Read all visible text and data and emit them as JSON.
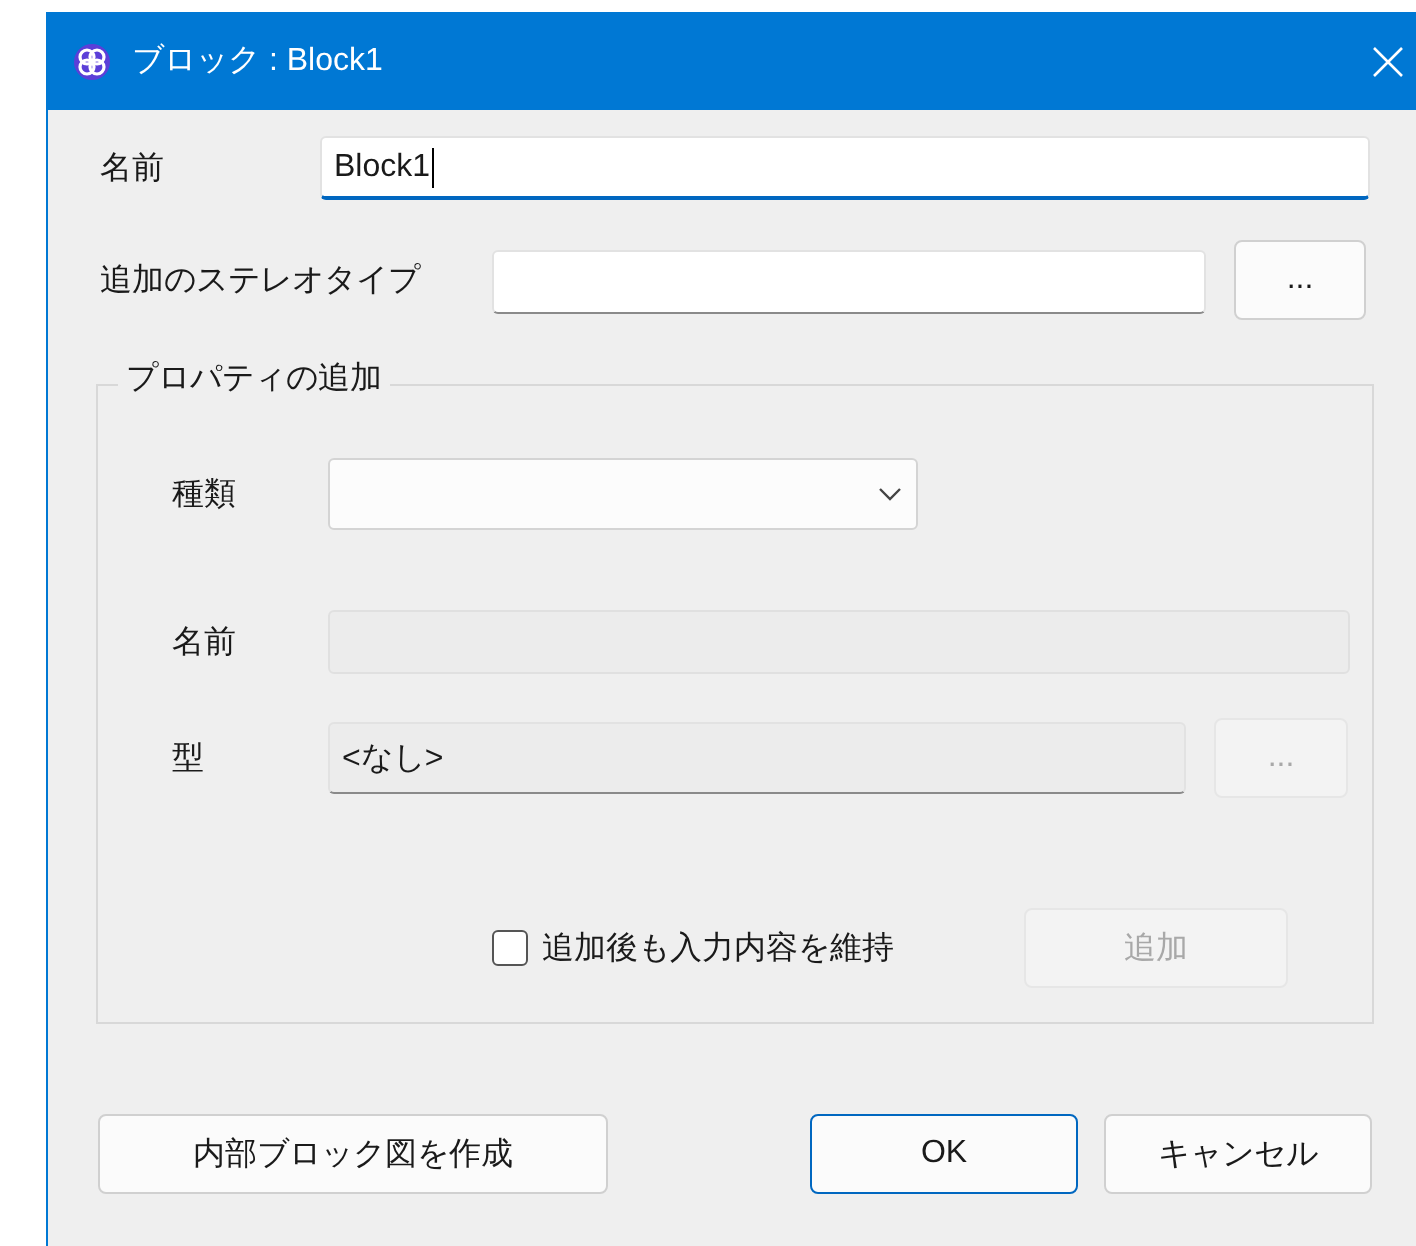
{
  "window": {
    "title": "ブロック : Block1"
  },
  "name": {
    "label": "名前",
    "value": "Block1",
    "focused": true
  },
  "stereotype": {
    "label": "追加のステレオタイプ",
    "browse_button": "..."
  },
  "add_property": {
    "legend": "プロパティの追加",
    "kind_field": {
      "label": "種類"
    },
    "name_field": {
      "label": "名前",
      "disabled": true
    },
    "type_field": {
      "label": "型",
      "value": "<なし>",
      "disabled": true
    },
    "type_browse_button": {
      "label": "...",
      "disabled": true
    },
    "keep_input": {
      "label": "追加後も入力内容を維持",
      "checked": false
    },
    "add_button": {
      "label": "追加",
      "disabled": true
    }
  },
  "buttons": [
    {
      "label": "内部ブロック図を作成",
      "default": false
    },
    {
      "label": "OK",
      "default": true
    },
    {
      "label": "キャンセル",
      "default": false
    }
  ]
}
